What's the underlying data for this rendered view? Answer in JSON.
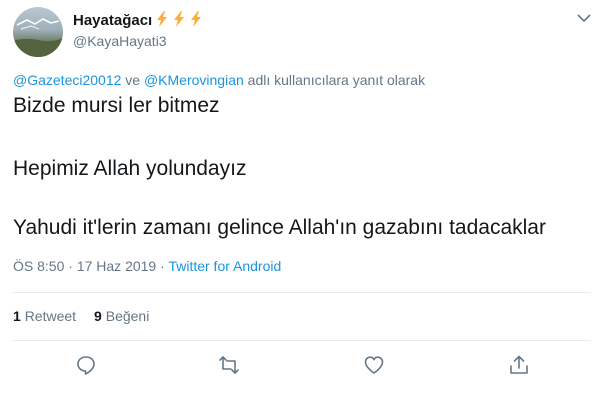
{
  "author": {
    "display_name": "Hayatağacı",
    "name_emoji": [
      "high-voltage-emoji",
      "high-voltage-emoji",
      "high-voltage-emoji"
    ],
    "handle": "@KayaHayati3"
  },
  "reply_context": {
    "mention_1": "@Gazeteci20012",
    "connector": " ve ",
    "mention_2": "@KMerovingian",
    "suffix": " adlı kullanıcılara yanıt olarak"
  },
  "tweet": {
    "lines": [
      "Bizde mursi ler bitmez",
      "Hepimiz Allah yolundayız",
      "Yahudi it'lerin zamanı gelince Allah'ın gazabını tadacaklar"
    ]
  },
  "meta": {
    "time": "ÖS 8:50",
    "separator": " · ",
    "date": "17 Haz 2019",
    "source": "Twitter for Android"
  },
  "stats": {
    "retweets_count": "1",
    "retweets_label": "Retweet",
    "likes_count": "9",
    "likes_label": "Beğeni"
  },
  "actions": [
    "reply-icon",
    "retweet-icon",
    "like-icon",
    "share-icon"
  ],
  "colors": {
    "text": "#14171a",
    "secondary": "#657786",
    "link": "#1b95e0",
    "divider": "#e6ecf0",
    "icon": "#657786"
  }
}
